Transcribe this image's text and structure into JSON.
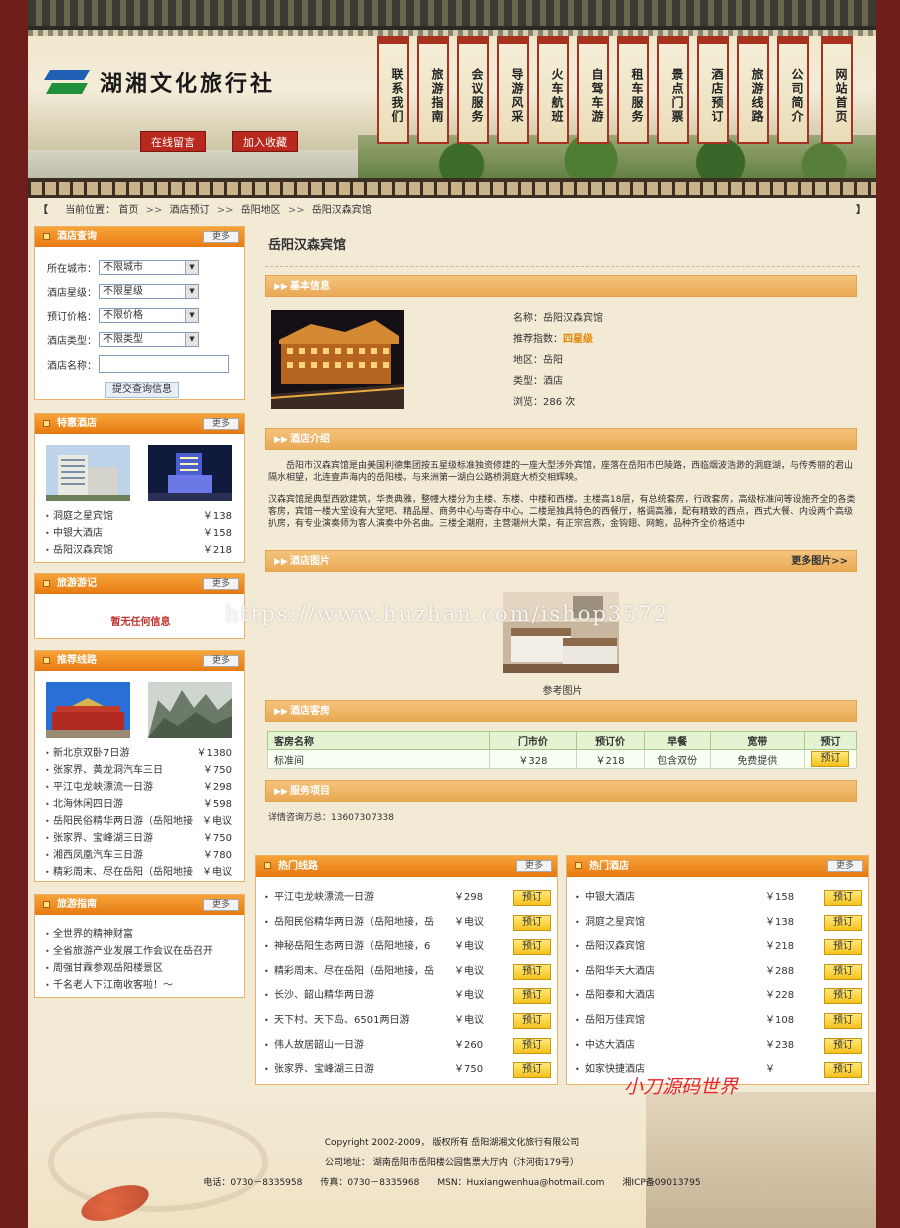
{
  "site": {
    "title": "湖湘文化旅行社"
  },
  "header": {
    "btn_message": "在线留言",
    "btn_favorite": "加入收藏",
    "nav": [
      "联系我们",
      "旅游指南",
      "会议服务",
      "导游风采",
      "火车航班",
      "自驾车游",
      "租车服务",
      "景点门票",
      "酒店预订",
      "旅游线路",
      "公司简介",
      "网站首页"
    ]
  },
  "breadcrumb": {
    "lead": "【",
    "tail": "】",
    "prefix": "当前位置：",
    "items": [
      "首页",
      "酒店预订",
      "岳阳地区",
      "岳阳汉森宾馆"
    ],
    "sep": ">>"
  },
  "search_box": {
    "title": "酒店查询",
    "more": "更多",
    "city_label": "所在城市：",
    "city_value": "不限城市",
    "star_label": "酒店星级：",
    "star_value": "不限星级",
    "price_label": "预订价格：",
    "price_value": "不限价格",
    "type_label": "酒店类型：",
    "type_value": "不限类型",
    "name_label": "酒店名称：",
    "submit": "提交查询信息"
  },
  "special_hotels": {
    "title": "特惠酒店",
    "more": "更多",
    "items": [
      {
        "name": "洞庭之星宾馆",
        "price": "￥138"
      },
      {
        "name": "中银大酒店",
        "price": "￥158"
      },
      {
        "name": "岳阳汉森宾馆",
        "price": "￥218"
      }
    ]
  },
  "travel_notes": {
    "title": "旅游游记",
    "more": "更多",
    "empty": "暂无任何信息"
  },
  "recommended_routes": {
    "title": "推荐线路",
    "more": "更多",
    "items": [
      {
        "name": "新北京双卧7日游",
        "price": "￥1380"
      },
      {
        "name": "张家界、黄龙洞汽车三日",
        "price": "￥750"
      },
      {
        "name": "平江屯龙峡漂流一日游",
        "price": "￥298"
      },
      {
        "name": "北海休闲四日游",
        "price": "￥598"
      },
      {
        "name": "岳阳民俗精华两日游（岳阳地接",
        "price": "￥电议"
      },
      {
        "name": "张家界、宝峰湖三日游",
        "price": "￥750"
      },
      {
        "name": "湘西凤凰汽车三日游",
        "price": "￥780"
      },
      {
        "name": "精彩周末、尽在岳阳（岳阳地接",
        "price": "￥电议"
      }
    ]
  },
  "travel_guide": {
    "title": "旅游指南",
    "more": "更多",
    "items": [
      "全世界的精神财富",
      "全省旅游产业发展工作会议在岳召开",
      "周强甘霖参观岳阳楼景区",
      "千名老人下江南收客啦！～"
    ]
  },
  "hotel": {
    "title": "岳阳汉森宾馆",
    "basic_section": "基本信息",
    "name_line": "名称：岳阳汉森宾馆",
    "rec_label": "推荐指数：",
    "rec_value": "四星级",
    "area_line": "地区：岳阳",
    "type_line": "类型：酒店",
    "views_line": "浏览：286 次",
    "intro_section": "酒店介绍",
    "intro_p1": "　　岳阳市汉森宾馆是由美国利德集团按五星级标准独资修建的一座大型涉外宾馆，座落在岳阳市巴陵路，西临烟波浩渺的洞庭湖，与传秀丽的君山隔水相望，北连壹声海内的岳阳楼。与来洲第一湖白公路桥洞庭大桥交相辉映。",
    "intro_p2": "汉森宾馆是典型西欧建筑，华贵典雅，整幢大楼分为主楼、东楼、中楼和西楼。主楼高18层，有总统套房，行政套房，高级标准间等设施齐全的各类客房，宾馆一楼大堂设有大堂吧、精品屋、商务中心与寄存中心。二楼是独具特色的西餐厅，格调高雅，配有精致的西点，西式大餐、内设两个高级扒房，有专业演奏师为客人演奏中外名曲。三楼全潮府，主营潮州大菜，有正宗宫燕，金钩翅、网鲍，品种齐全价格适中",
    "pics_section": "酒店图片",
    "pics_more": "更多图片>>",
    "pic_caption": "参考图片",
    "rooms_section": "酒店客房",
    "room_headers": [
      "客房名称",
      "门市价",
      "预订价",
      "早餐",
      "宽带",
      "预订"
    ],
    "rooms": [
      {
        "name": "标准间",
        "rack": "￥328",
        "book": "￥218",
        "breakfast": "包含双份",
        "broadband": "免费提供",
        "action": "预订"
      }
    ],
    "service_section": "服务项目",
    "service_text": "详情咨询万总：13607307338"
  },
  "hot_routes": {
    "title": "热门线路",
    "more": "更多",
    "items": [
      {
        "name": "平江屯龙峡漂流一日游",
        "price": "￥298",
        "action": "预订"
      },
      {
        "name": "岳阳民俗精华两日游（岳阳地接，岳",
        "price": "￥电议",
        "action": "预订"
      },
      {
        "name": "神秘岳阳生态两日游（岳阳地接，6",
        "price": "￥电议",
        "action": "预订"
      },
      {
        "name": "精彩周末、尽在岳阳（岳阳地接，岳",
        "price": "￥电议",
        "action": "预订"
      },
      {
        "name": "长沙、韶山精华两日游",
        "price": "￥电议",
        "action": "预订"
      },
      {
        "name": "天下村、天下岛、6501两日游",
        "price": "￥电议",
        "action": "预订"
      },
      {
        "name": "伟人故居韶山一日游",
        "price": "￥260",
        "action": "预订"
      },
      {
        "name": "张家界、宝峰湖三日游",
        "price": "￥750",
        "action": "预订"
      }
    ]
  },
  "hot_hotels": {
    "title": "热门酒店",
    "more": "更多",
    "items": [
      {
        "name": "中银大酒店",
        "price": "￥158",
        "action": "预订"
      },
      {
        "name": "洞庭之星宾馆",
        "price": "￥138",
        "action": "预订"
      },
      {
        "name": "岳阳汉森宾馆",
        "price": "￥218",
        "action": "预订"
      },
      {
        "name": "岳阳华天大酒店",
        "price": "￥288",
        "action": "预订"
      },
      {
        "name": "岳阳泰和大酒店",
        "price": "￥228",
        "action": "预订"
      },
      {
        "name": "岳阳万佳宾馆",
        "price": "￥108",
        "action": "预订"
      },
      {
        "name": "中达大酒店",
        "price": "￥238",
        "action": "预订"
      },
      {
        "name": "如家快捷酒店",
        "price": "￥",
        "action": "预订"
      }
    ]
  },
  "footer": {
    "copyright": "Copyright 2002-2009， 版权所有 岳阳湖湘文化旅行有限公司",
    "address": "公司地址： 湖南岳阳市岳阳楼公园售票大厅内（汴河街179号）",
    "contact": "电话：0730－8335958　　传真：0730－8335968　　MSN：Huxiangwenhua@hotmail.com　　湘ICP备09013795"
  },
  "watermarks": {
    "url": "https://www.huzhan.com/ishop3572",
    "brand": "小刀源码世界"
  },
  "colors": {
    "accent_orange": "#e67a10",
    "header_red": "#b8281c",
    "frame": "#6e1f1c",
    "price_highlight": "#e08400"
  },
  "icons": {
    "box_bullet": "square-bullet-icon",
    "section_chevron": "double-chevron-icon",
    "select_arrow": "dropdown-arrow-icon"
  }
}
